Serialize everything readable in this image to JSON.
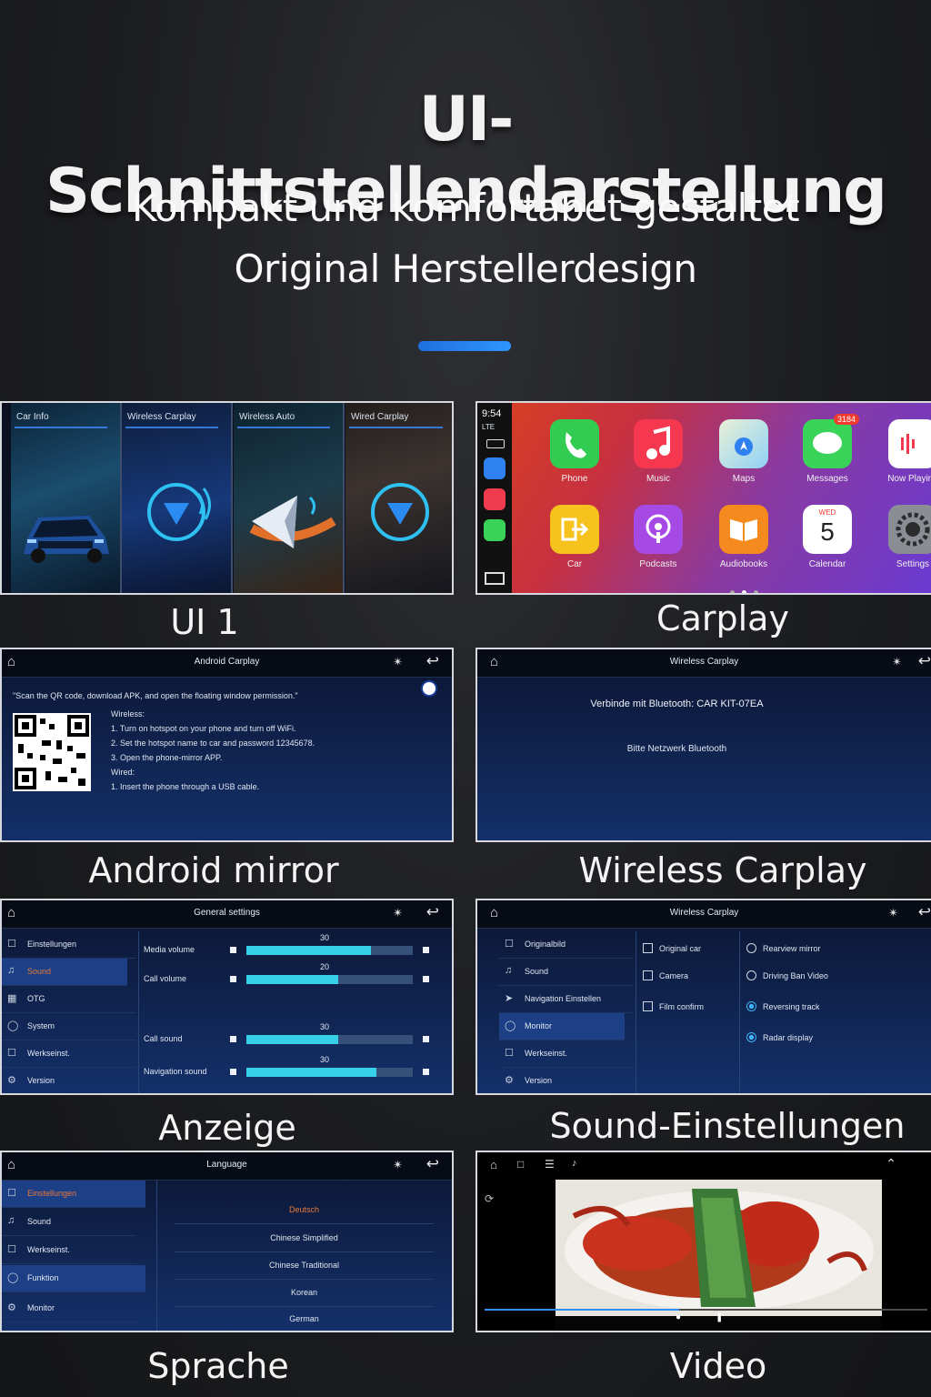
{
  "header": {
    "title": "UI-Schnittstellendarstellung",
    "subtitle1": "Kompakt und komfortabet gestaltet",
    "subtitle2": "Original Herstellerdesign"
  },
  "colors": {
    "accent": "#2a84f5",
    "background": "#1c1d20",
    "slider_fill": "#36d0e8"
  },
  "panels": {
    "ui1": {
      "caption": "UI 1",
      "columns": [
        "Car Info",
        "Wireless Carplay",
        "Wireless Auto",
        "Wired Carplay"
      ]
    },
    "carplay": {
      "caption": "Carplay",
      "time": "9:54",
      "signal": "LTE",
      "apps_row1": [
        "Phone",
        "Music",
        "Maps",
        "Messages",
        "Now Playing"
      ],
      "apps_row2": [
        "Car",
        "Podcasts",
        "Audiobooks",
        "Calendar",
        "Settings"
      ],
      "badge": "3184",
      "calendar_day": "WED",
      "calendar_date": "5"
    },
    "android": {
      "caption": "Android mirror",
      "title": "Android Carplay",
      "instruction": "\"Scan the QR code, download APK, and open the floating window permission.\"",
      "lines": [
        "Wireless:",
        "1. Turn on hotspot on your phone and turn off WiFi.",
        "2. Set the hotspot name to car and password 12345678.",
        "3. Open the phone-mirror APP.",
        "Wired:",
        "1. Insert the phone through a USB cable."
      ]
    },
    "wireless": {
      "caption": "Wireless Carplay",
      "title": "Wireless Carplay",
      "connect_text": "Verbinde mit Bluetooth: CAR KIT-07EA",
      "hint_text": "Bitte Netzwerk Bluetooth"
    },
    "anzeige": {
      "caption": "Anzeige",
      "title": "General settings",
      "menu": [
        "Einstellungen",
        "Sound",
        "OTG",
        "System",
        "Werkseinst.",
        "Version"
      ],
      "sliders": [
        {
          "label": "Media volume",
          "value": "30",
          "level": 0.75
        },
        {
          "label": "Call volume",
          "value": "20",
          "level": 0.55
        },
        {
          "label": "Call sound",
          "value": "30",
          "level": 0.55
        },
        {
          "label": "Navigation sound",
          "value": "30",
          "level": 0.78
        }
      ]
    },
    "sound": {
      "caption": "Sound-Einstellungen",
      "title": "Wireless Carplay",
      "menu": [
        "Originalbild",
        "Sound",
        "Navigation Einstellen",
        "Monitor",
        "Werkseinst.",
        "Version"
      ],
      "checkboxes": [
        "Original car",
        "Camera",
        "Film confirm"
      ],
      "radios": [
        {
          "label": "Rearview mirror",
          "on": false
        },
        {
          "label": "Driving Ban Video",
          "on": false
        },
        {
          "label": "Reversing track",
          "on": true
        },
        {
          "label": "Radar display",
          "on": true
        }
      ]
    },
    "sprache": {
      "caption": "Sprache",
      "title": "Language",
      "menu": [
        "Einstellungen",
        "Sound",
        "Werkseinst.",
        "Funktion",
        "Monitor"
      ],
      "languages": [
        "Deutsch",
        "Chinese Simplified",
        "Chinese Traditional",
        "Korean",
        "German"
      ]
    },
    "video": {
      "caption": "Video"
    }
  }
}
